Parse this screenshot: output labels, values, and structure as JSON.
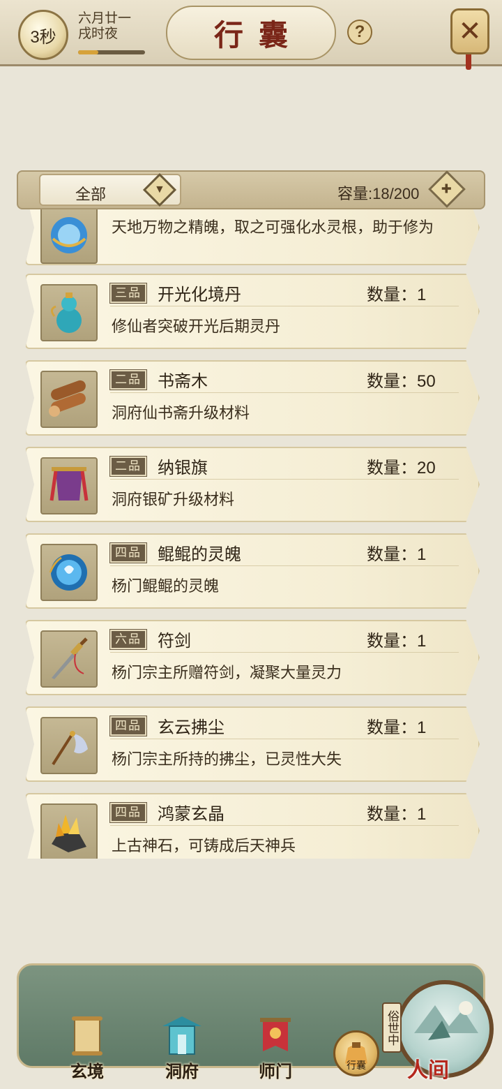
{
  "header": {
    "timer": "3秒",
    "date_line1": "六月廿一",
    "date_line2": "戌时夜",
    "day_progress": 0.3,
    "title": "行囊",
    "help_label": "?",
    "close_label": "✕"
  },
  "filter": {
    "selected": "全部",
    "capacity": "容量:18/200"
  },
  "items": [
    {
      "grade": "",
      "name": "",
      "qty": "",
      "desc": "天地万物之精魄，取之可强化水灵根，助于修为",
      "icon": "water-spirit-orb-icon"
    },
    {
      "grade": "三品",
      "name": "开光化境丹",
      "qty": "数量：1",
      "desc": "修仙者突破开光后期灵丹",
      "icon": "pill-gourd-icon"
    },
    {
      "grade": "二品",
      "name": "书斋木",
      "qty": "数量：50",
      "desc": "洞府仙书斋升级材料",
      "icon": "wood-logs-icon"
    },
    {
      "grade": "二品",
      "name": "纳银旗",
      "qty": "数量：20",
      "desc": "洞府银矿升级材料",
      "icon": "banner-flag-icon"
    },
    {
      "grade": "四品",
      "name": "鲲鲲的灵魄",
      "qty": "数量：1",
      "desc": "杨门鲲鲲的灵魄",
      "icon": "blue-spirit-orb-icon"
    },
    {
      "grade": "六品",
      "name": "符剑",
      "qty": "数量：1",
      "desc": "杨门宗主所赠符剑，凝聚大量灵力",
      "icon": "sword-icon"
    },
    {
      "grade": "四品",
      "name": "玄云拂尘",
      "qty": "数量：1",
      "desc": "杨门宗主所持的拂尘，已灵性大失",
      "icon": "whisk-icon"
    },
    {
      "grade": "四品",
      "name": "鸿蒙玄晶",
      "qty": "数量：1",
      "desc": "上古神石，可铸成后天神兵",
      "icon": "crystal-ore-icon"
    }
  ],
  "nav": {
    "xuanjing": "玄境",
    "dongfu": "洞府",
    "shimen": "师门",
    "bag": "行囊",
    "world_status": "俗世中",
    "world": "人间"
  }
}
